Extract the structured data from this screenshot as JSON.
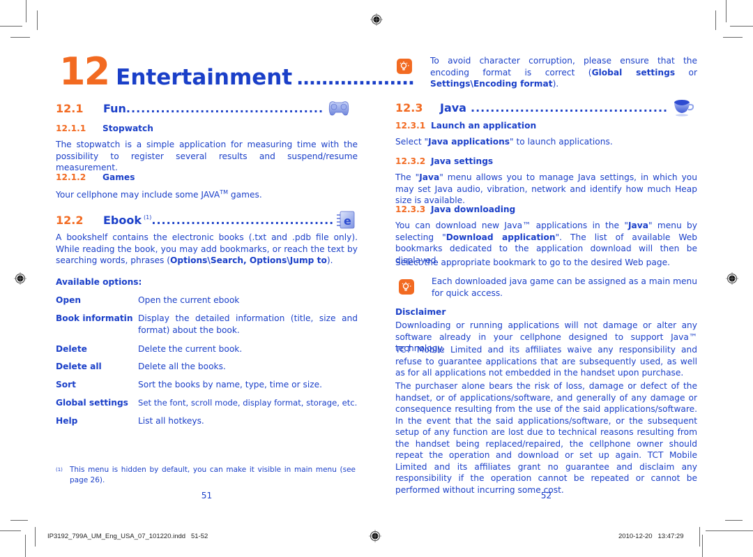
{
  "chapter": {
    "number": "12",
    "title": "Entertainment",
    "leader": "..................."
  },
  "left_page": {
    "sections": {
      "fun": {
        "number": "12.1",
        "title": "Fun",
        "icon": "gamepad-icon"
      },
      "stopwatch": {
        "number": "12.1.1",
        "title": "Stopwatch",
        "body": "The stopwatch is a simple application for measuring time with the possibility to register several results and suspend/resume measurement."
      },
      "games": {
        "number": "12.1.2",
        "title": "Games",
        "body_prefix": "Your cellphone may include some JAVA",
        "body_tm": "TM",
        "body_suffix": " games."
      },
      "ebook": {
        "number": "12.2",
        "title": "Ebook",
        "footnote_ref": "(1)",
        "icon": "ebook-icon",
        "body_prefix": "A bookshelf contains the electronic books (.txt and .pdb file only). While reading the book, you may add bookmarks, or reach the text by searching words, phrases (",
        "body_bold": "Options\\Search, Options\\Jump to",
        "body_suffix": ")."
      }
    },
    "options_heading": "Available options:",
    "options": [
      {
        "key": "Open",
        "value": "Open the current ebook"
      },
      {
        "key": "Book informatin",
        "value": "Display the detailed information (title, size and format) about the book."
      },
      {
        "key": "Delete",
        "value": "Delete the current book."
      },
      {
        "key": "Delete all",
        "value": "Delete all the books."
      },
      {
        "key": "Sort",
        "value": "Sort the books by name, type, time or size."
      },
      {
        "key": "Global settings",
        "value": "Set the font, scroll mode, display format, storage, etc."
      },
      {
        "key": "Help",
        "value": "List all hotkeys."
      }
    ],
    "footnote": {
      "mark": "(1)",
      "text": "This menu is hidden by default, you can make it visible in main menu (see page 26)."
    },
    "page_number": "51"
  },
  "right_page": {
    "tip1": {
      "icon": "lightbulb-tip-icon",
      "text_prefix": "To avoid character corruption, please ensure that the encoding format is correct (",
      "bold1": "Global settings",
      "mid": " or ",
      "bold2": "Settings\\Encoding format",
      "text_suffix": ")."
    },
    "java": {
      "number": "12.3",
      "title": "Java",
      "icon": "coffee-cup-icon"
    },
    "launch": {
      "number": "12.3.1",
      "title": "Launch an application",
      "body_prefix": "Select \"",
      "body_bold": "Java applications",
      "body_suffix": "\" to launch applications."
    },
    "settings": {
      "number": "12.3.2",
      "title": "Java settings",
      "body_prefix": "The \"",
      "body_bold": "Java",
      "body_suffix": "\" menu allows you to manage Java settings, in which you may set Java audio, vibration, network and identify how much Heap size is available."
    },
    "downloading": {
      "number": "12.3.3",
      "title": "Java downloading",
      "body_p1_a": "You can download new Java™ applications in the \"",
      "body_p1_b": "Java",
      "body_p1_c": "\" menu by selecting \"",
      "body_p1_d": "Download application",
      "body_p1_e": "\". The list of available Web bookmarks dedicated to the application download will then be displayed.",
      "body_p2": "Select the appropriate bookmark to go to the desired Web page."
    },
    "tip2": {
      "icon": "lightbulb-tip-icon",
      "text": "Each downloaded java game can be assigned as a main menu for quick access."
    },
    "disclaimer": {
      "heading": "Disclaimer",
      "paragraphs": [
        "Downloading or running applications will not damage or alter any software already in your cellphone designed to support Java™ technology.",
        "TCT Mobile Limited and its affiliates waive any responsibility and refuse to guarantee applications that are subsequently used, as well as for all applications not embedded in the handset upon purchase.",
        "The purchaser alone bears the risk of loss, damage or defect of the handset, or of applications/software, and generally of any damage or consequence resulting from the use of the said applications/software. In the event that the said applications/software, or the subsequent setup of any function are lost due to technical reasons resulting from the handset being replaced/repaired, the cellphone owner should repeat the operation and download or set up again. TCT Mobile Limited and its affiliates grant no guarantee and disclaim any responsibility if the operation cannot be repeated or cannot be performed without incurring some cost."
      ]
    },
    "page_number": "52"
  },
  "print_footer": {
    "file_name": "IP3192_799A_UM_Eng_USA_07_101220.indd   51-52",
    "timestamp": "2010-12-20   13:47:29"
  },
  "dot_leader": "................................................................................................",
  "colors": {
    "text": "#1a3fc8",
    "accent": "#f26a21"
  }
}
